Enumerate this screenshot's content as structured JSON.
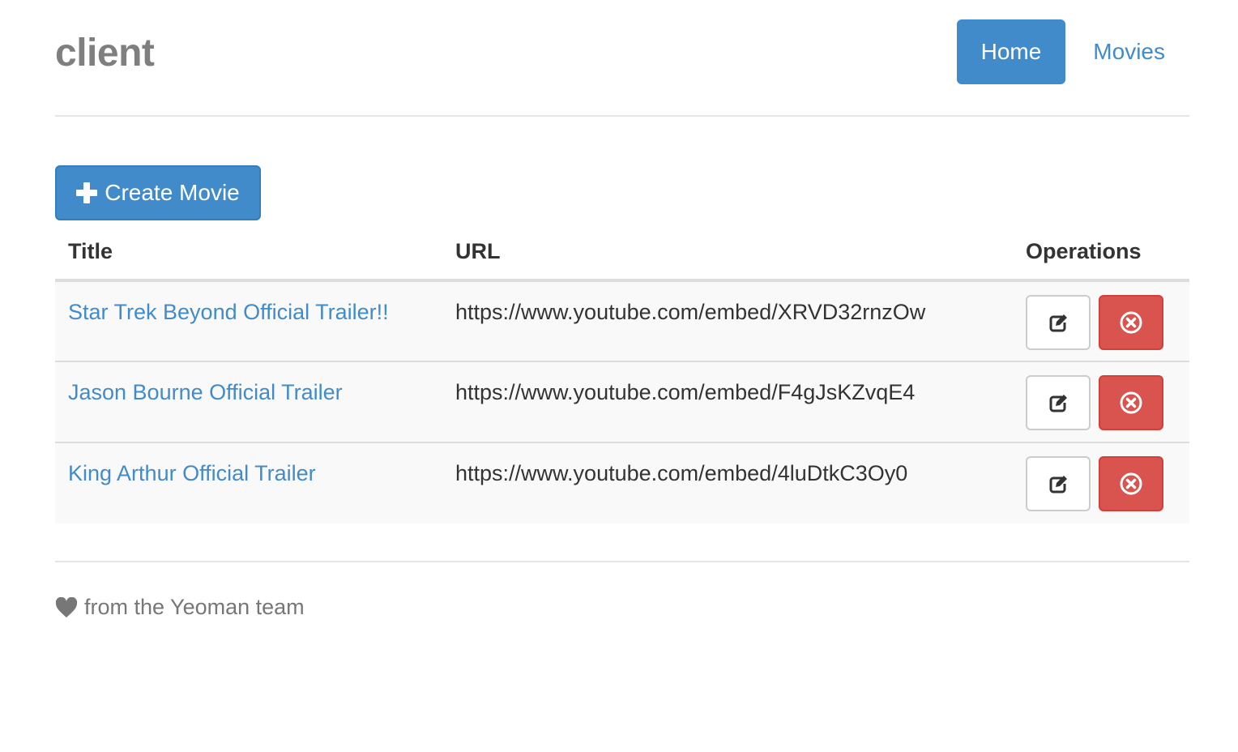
{
  "header": {
    "brand": "client",
    "nav": [
      {
        "label": "Home",
        "active": true
      },
      {
        "label": "Movies",
        "active": false
      }
    ]
  },
  "toolbar": {
    "create_label": "Create Movie",
    "create_icon": "plus-icon"
  },
  "table": {
    "columns": [
      "Title",
      "URL",
      "Operations"
    ],
    "rows": [
      {
        "title": "Star Trek Beyond Official Trailer!!",
        "url": "https://www.youtube.com/embed/XRVD32rnzOw"
      },
      {
        "title": "Jason Bourne Official Trailer",
        "url": "https://www.youtube.com/embed/F4gJsKZvqE4"
      },
      {
        "title": "King Arthur Official Trailer",
        "url": "https://www.youtube.com/embed/4luDtkC3Oy0"
      }
    ],
    "operations_icons": [
      "edit-icon",
      "remove-circle-icon"
    ]
  },
  "footer": {
    "text": "from the Yeoman team",
    "icon": "heart-icon"
  },
  "colors": {
    "primary": "#428bca",
    "danger": "#d9534f",
    "muted": "#777777"
  }
}
